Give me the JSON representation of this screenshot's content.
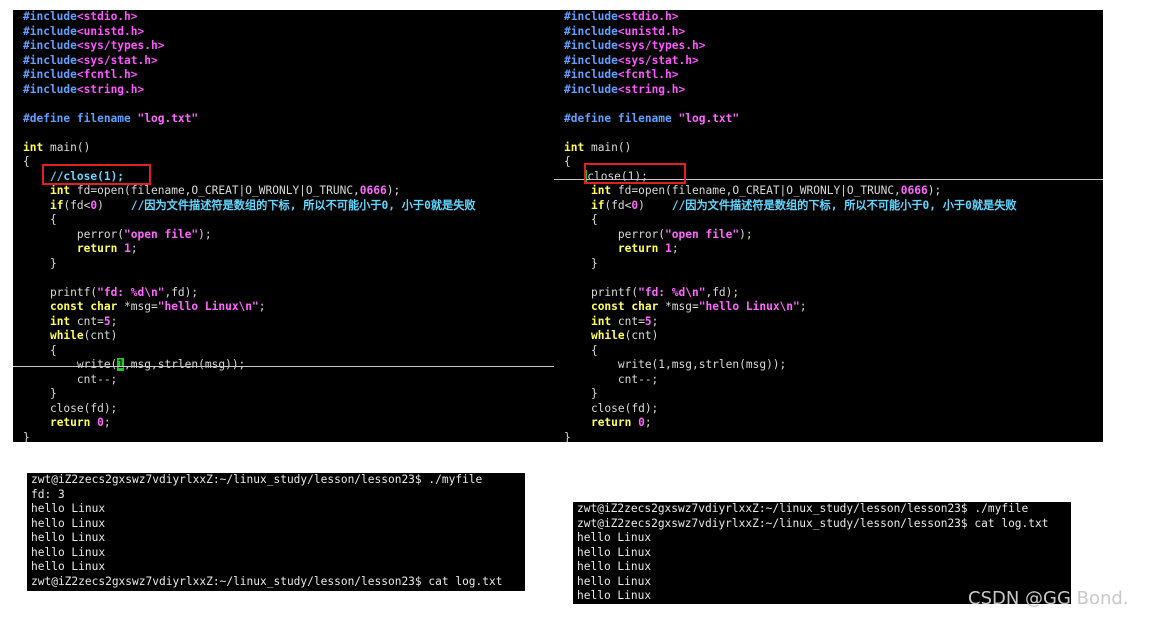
{
  "left_editor": {
    "lines": [
      [
        [
          "pp",
          "#include"
        ],
        [
          "hdr",
          "<stdio.h>"
        ]
      ],
      [
        [
          "pp",
          "#include"
        ],
        [
          "hdr",
          "<unistd.h>"
        ]
      ],
      [
        [
          "pp",
          "#include"
        ],
        [
          "hdr",
          "<sys/types.h>"
        ]
      ],
      [
        [
          "pp",
          "#include"
        ],
        [
          "hdr",
          "<sys/stat.h>"
        ]
      ],
      [
        [
          "pp",
          "#include"
        ],
        [
          "hdr",
          "<fcntl.h>"
        ]
      ],
      [
        [
          "pp",
          "#include"
        ],
        [
          "hdr",
          "<string.h>"
        ]
      ],
      [],
      [
        [
          "pp",
          "#define filename "
        ],
        [
          "str",
          "\"log.txt\""
        ]
      ],
      [],
      [
        [
          "kw",
          "int"
        ],
        [
          "fn",
          " main()"
        ]
      ],
      [
        [
          "fn",
          "{"
        ]
      ],
      [
        [
          "fn",
          "    "
        ],
        [
          "cm",
          "//close(1);"
        ]
      ],
      [
        [
          "fn",
          "    "
        ],
        [
          "kw",
          "int"
        ],
        [
          "fn",
          " fd=open(filename,O_CREAT|O_WRONLY|O_TRUNC,"
        ],
        [
          "num",
          "0666"
        ],
        [
          "fn",
          ");"
        ]
      ],
      [
        [
          "fn",
          "    "
        ],
        [
          "kw",
          "if"
        ],
        [
          "fn",
          "(fd<"
        ],
        [
          "num",
          "0"
        ],
        [
          "fn",
          ")    "
        ],
        [
          "cm",
          "//因为文件描述符是数组的下标, 所以不可能小于0, 小于0就是失败"
        ]
      ],
      [
        [
          "fn",
          "    {"
        ]
      ],
      [
        [
          "fn",
          "        perror("
        ],
        [
          "str",
          "\"open file\""
        ],
        [
          "fn",
          ");"
        ]
      ],
      [
        [
          "fn",
          "        "
        ],
        [
          "kw",
          "return"
        ],
        [
          "fn",
          " "
        ],
        [
          "num",
          "1"
        ],
        [
          "fn",
          ";"
        ]
      ],
      [
        [
          "fn",
          "    }"
        ]
      ],
      [],
      [
        [
          "fn",
          "    printf("
        ],
        [
          "str",
          "\"fd: %d\\n\""
        ],
        [
          "fn",
          ",fd);"
        ]
      ],
      [
        [
          "fn",
          "    "
        ],
        [
          "kw",
          "const char"
        ],
        [
          "fn",
          " *msg="
        ],
        [
          "str",
          "\"hello Linux\\n\""
        ],
        [
          "fn",
          ";"
        ]
      ],
      [
        [
          "fn",
          "    "
        ],
        [
          "kw",
          "int"
        ],
        [
          "fn",
          " cnt="
        ],
        [
          "num",
          "5"
        ],
        [
          "fn",
          ";"
        ]
      ],
      [
        [
          "fn",
          "    "
        ],
        [
          "kw",
          "while"
        ],
        [
          "fn",
          "(cnt)"
        ]
      ],
      [
        [
          "fn",
          "    {"
        ]
      ],
      [
        [
          "fn",
          "        write("
        ],
        [
          "cursor-l",
          "1"
        ],
        [
          "fn",
          ",msg,strlen(msg));"
        ]
      ],
      [
        [
          "fn",
          "        cnt--;"
        ]
      ],
      [
        [
          "fn",
          "    }"
        ]
      ],
      [
        [
          "fn",
          "    close(fd);"
        ]
      ],
      [
        [
          "fn",
          "    "
        ],
        [
          "kw",
          "return"
        ],
        [
          "fn",
          " "
        ],
        [
          "num",
          "0"
        ],
        [
          "fn",
          ";"
        ]
      ],
      [
        [
          "fn",
          "}"
        ]
      ]
    ]
  },
  "right_editor": {
    "lines": [
      [
        [
          "pp",
          "#include"
        ],
        [
          "hdr",
          "<stdio.h>"
        ]
      ],
      [
        [
          "pp",
          "#include"
        ],
        [
          "hdr",
          "<unistd.h>"
        ]
      ],
      [
        [
          "pp",
          "#include"
        ],
        [
          "hdr",
          "<sys/types.h>"
        ]
      ],
      [
        [
          "pp",
          "#include"
        ],
        [
          "hdr",
          "<sys/stat.h>"
        ]
      ],
      [
        [
          "pp",
          "#include"
        ],
        [
          "hdr",
          "<fcntl.h>"
        ]
      ],
      [
        [
          "pp",
          "#include"
        ],
        [
          "hdr",
          "<string.h>"
        ]
      ],
      [],
      [
        [
          "pp",
          "#define filename "
        ],
        [
          "str",
          "\"log.txt\""
        ]
      ],
      [],
      [
        [
          "kw",
          "int"
        ],
        [
          "fn",
          " main()"
        ]
      ],
      [
        [
          "fn",
          "{"
        ]
      ],
      [
        [
          "fn",
          "   "
        ],
        [
          "cursor-r",
          " "
        ],
        [
          "fn",
          "close(1);"
        ]
      ],
      [
        [
          "fn",
          "    "
        ],
        [
          "kw",
          "int"
        ],
        [
          "fn",
          " fd=open(filename,O_CREAT|O_WRONLY|O_TRUNC,"
        ],
        [
          "num",
          "0666"
        ],
        [
          "fn",
          ");"
        ]
      ],
      [
        [
          "fn",
          "    "
        ],
        [
          "kw",
          "if"
        ],
        [
          "fn",
          "(fd<"
        ],
        [
          "num",
          "0"
        ],
        [
          "fn",
          ")    "
        ],
        [
          "cm",
          "//因为文件描述符是数组的下标, 所以不可能小于0, 小于0就是失败"
        ]
      ],
      [
        [
          "fn",
          "    {"
        ]
      ],
      [
        [
          "fn",
          "        perror("
        ],
        [
          "str",
          "\"open file\""
        ],
        [
          "fn",
          ");"
        ]
      ],
      [
        [
          "fn",
          "        "
        ],
        [
          "kw",
          "return"
        ],
        [
          "fn",
          " "
        ],
        [
          "num",
          "1"
        ],
        [
          "fn",
          ";"
        ]
      ],
      [
        [
          "fn",
          "    }"
        ]
      ],
      [],
      [
        [
          "fn",
          "    printf("
        ],
        [
          "str",
          "\"fd: %d\\n\""
        ],
        [
          "fn",
          ",fd);"
        ]
      ],
      [
        [
          "fn",
          "    "
        ],
        [
          "kw",
          "const char"
        ],
        [
          "fn",
          " *msg="
        ],
        [
          "str",
          "\"hello Linux\\n\""
        ],
        [
          "fn",
          ";"
        ]
      ],
      [
        [
          "fn",
          "    "
        ],
        [
          "kw",
          "int"
        ],
        [
          "fn",
          " cnt="
        ],
        [
          "num",
          "5"
        ],
        [
          "fn",
          ";"
        ]
      ],
      [
        [
          "fn",
          "    "
        ],
        [
          "kw",
          "while"
        ],
        [
          "fn",
          "(cnt)"
        ]
      ],
      [
        [
          "fn",
          "    {"
        ]
      ],
      [
        [
          "fn",
          "        write(1,msg,strlen(msg));"
        ]
      ],
      [
        [
          "fn",
          "        cnt--;"
        ]
      ],
      [
        [
          "fn",
          "    }"
        ]
      ],
      [
        [
          "fn",
          "    close(fd);"
        ]
      ],
      [
        [
          "fn",
          "    "
        ],
        [
          "kw",
          "return"
        ],
        [
          "fn",
          " "
        ],
        [
          "num",
          "0"
        ],
        [
          "fn",
          ";"
        ]
      ],
      [
        [
          "fn",
          "}"
        ]
      ]
    ]
  },
  "left_terminal": {
    "lines": [
      "zwt@iZ2zecs2gxswz7vdiyrlxxZ:~/linux_study/lesson/lesson23$ ./myfile",
      "fd: 3",
      "hello Linux",
      "hello Linux",
      "hello Linux",
      "hello Linux",
      "hello Linux",
      "zwt@iZ2zecs2gxswz7vdiyrlxxZ:~/linux_study/lesson/lesson23$ cat log.txt"
    ]
  },
  "right_terminal": {
    "lines": [
      "zwt@iZ2zecs2gxswz7vdiyrlxxZ:~/linux_study/lesson/lesson23$ ./myfile",
      "zwt@iZ2zecs2gxswz7vdiyrlxxZ:~/linux_study/lesson/lesson23$ cat log.txt",
      "hello Linux",
      "hello Linux",
      "hello Linux",
      "hello Linux",
      "hello Linux"
    ]
  },
  "watermark": "CSDN @GG Bond.",
  "colors": {
    "preprocessor": "#5fa0ff",
    "header": "#ff55ff",
    "keyword": "#ffff55",
    "comment": "#5fd7ff",
    "highlight_box": "#e02020",
    "cursor": "#22c522"
  }
}
